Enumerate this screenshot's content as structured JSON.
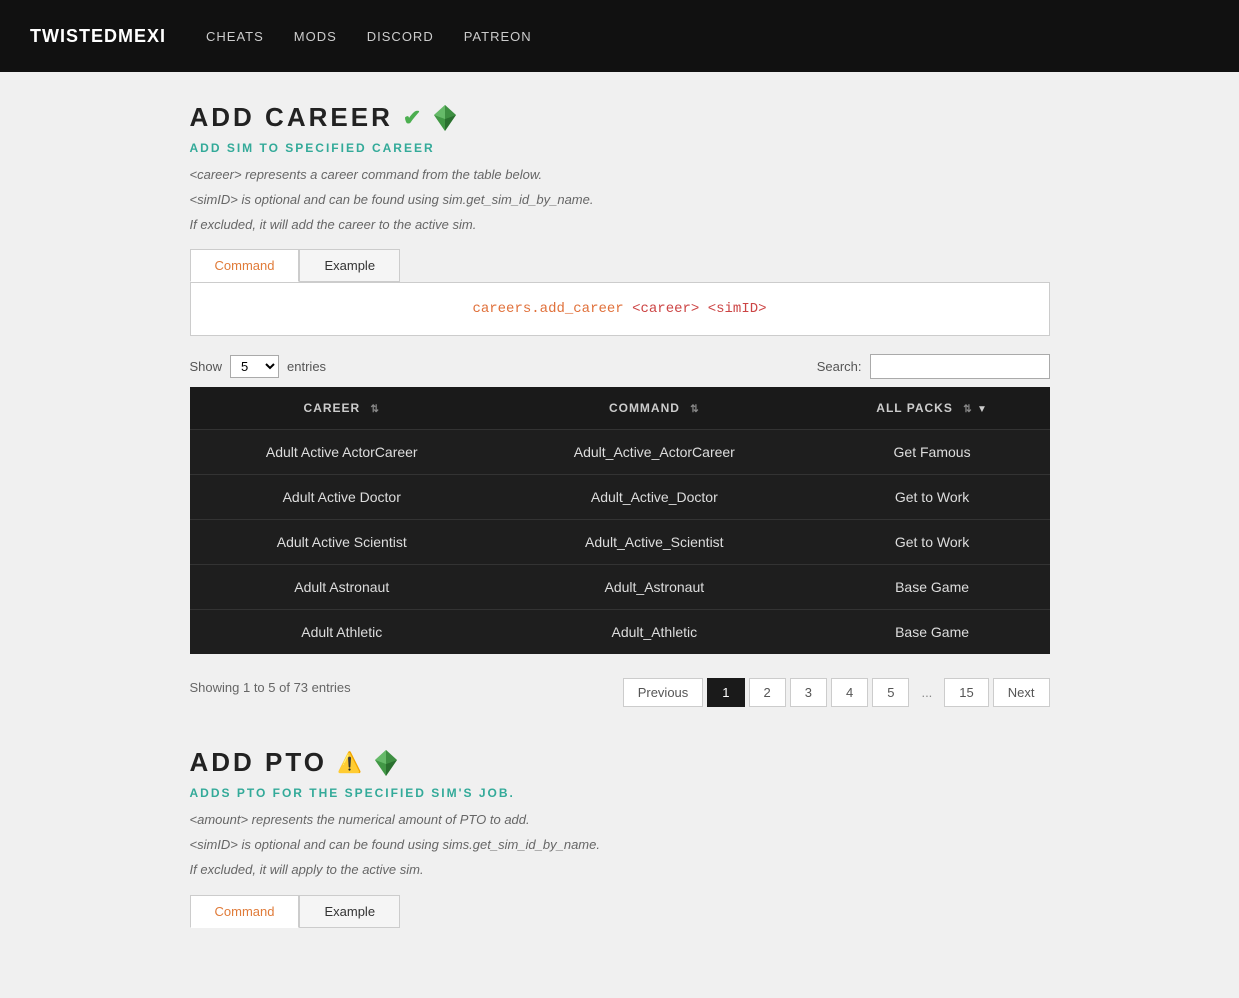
{
  "nav": {
    "brand": "TWISTEDMEXI",
    "links": [
      "CHEATS",
      "MODS",
      "DISCORD",
      "PATREON"
    ]
  },
  "add_career": {
    "title": "ADD CAREER",
    "subtitle": "ADD SIM TO SPECIFIED CAREER",
    "desc_lines": [
      "<career> represents a career command from the table below.",
      "<simID> is optional and can be found using sim.get_sim_id_by_name.",
      "If excluded, it will add the career to the active sim."
    ],
    "tab_command": "Command",
    "tab_example": "Example",
    "code": "careers.add_career <career> <simID>",
    "show_label": "Show",
    "show_value": "5",
    "entries_label": "entries",
    "search_label": "Search:",
    "search_placeholder": "",
    "columns": [
      "CAREER",
      "COMMAND",
      "ALL PACKS"
    ],
    "rows": [
      {
        "career": "Adult Active ActorCareer",
        "command": "Adult_Active_ActorCareer",
        "pack": "Get Famous"
      },
      {
        "career": "Adult Active Doctor",
        "command": "Adult_Active_Doctor",
        "pack": "Get to Work"
      },
      {
        "career": "Adult Active Scientist",
        "command": "Adult_Active_Scientist",
        "pack": "Get to Work"
      },
      {
        "career": "Adult Astronaut",
        "command": "Adult_Astronaut",
        "pack": "Base Game"
      },
      {
        "career": "Adult Athletic",
        "command": "Adult_Athletic",
        "pack": "Base Game"
      }
    ],
    "showing_text": "Showing 1 to 5 of 73 entries",
    "pagination": {
      "previous": "Previous",
      "pages": [
        "1",
        "2",
        "3",
        "4",
        "5",
        "...",
        "15"
      ],
      "next": "Next",
      "active_page": "1"
    }
  },
  "add_pto": {
    "title": "ADD PTO",
    "subtitle": "ADDS PTO FOR THE SPECIFIED SIM'S JOB.",
    "desc_lines": [
      "<amount> represents the numerical amount of PTO to add.",
      "<simID> is optional and can be found using sims.get_sim_id_by_name.",
      "If excluded, it will apply to the active sim."
    ],
    "tab_command": "Command",
    "tab_example": "Example"
  },
  "colors": {
    "nav_bg": "#111111",
    "table_bg": "#1e1e1e",
    "header_bg": "#1a1a1a",
    "active_page_bg": "#1a1a1a",
    "subtitle_color": "#33aa99",
    "code_color": "#cc4444",
    "check_color": "#4caf50"
  }
}
